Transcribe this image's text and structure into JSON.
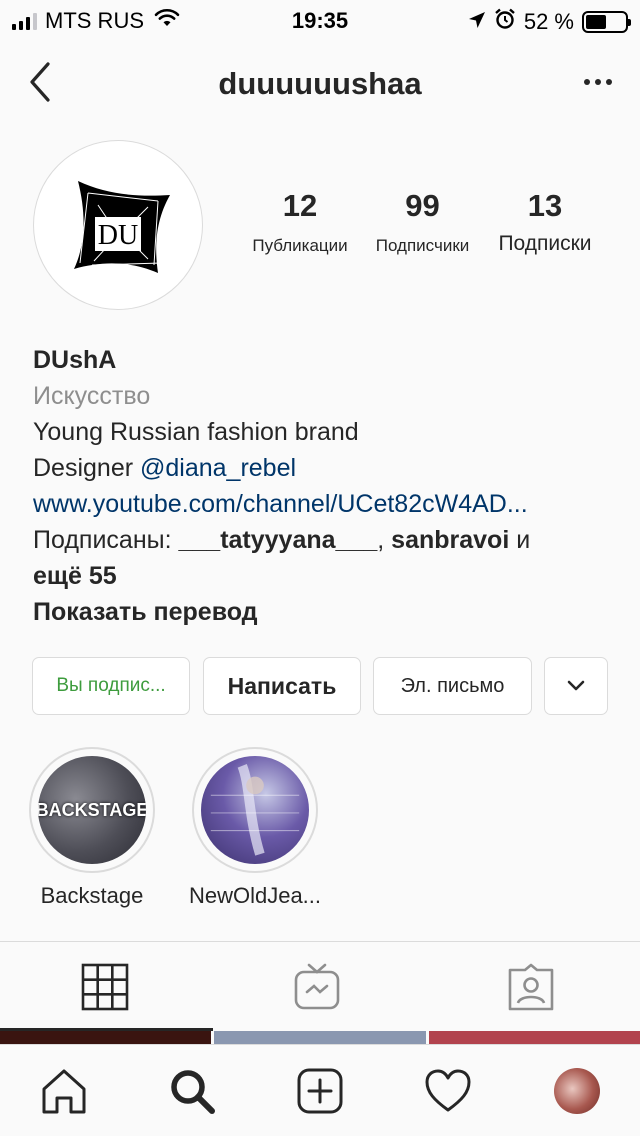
{
  "status_bar": {
    "carrier": "MTS RUS",
    "time": "19:35",
    "battery_percent": "52 %",
    "battery_level": 0.52,
    "icons": [
      "signal-icon",
      "wifi-icon",
      "location-arrow-icon",
      "alarm-clock-icon",
      "battery-icon"
    ]
  },
  "header": {
    "username": "duuuuuushaa",
    "icons": [
      "back-chevron-icon",
      "more-dots-icon"
    ]
  },
  "profile": {
    "avatar_text": "DU",
    "stats": [
      {
        "value": "12",
        "label": "Публикации"
      },
      {
        "value": "99",
        "label": "Подписчики"
      },
      {
        "value": "13",
        "label": "Подписки"
      }
    ]
  },
  "bio": {
    "name": "DUshA",
    "category": "Искусство",
    "line1": "Young Russian fashion brand",
    "designer_prefix": "Designer ",
    "designer_mention": "@diana_rebel",
    "website": "www.youtube.com/channel/UCet82cW4AD...",
    "followed_prefix": "Подписаны: ",
    "followed_user1": "___tatyyyana___",
    "followed_sep": ", ",
    "followed_user2": "sanbravoi",
    "followed_and": " и",
    "followed_more": "ещё 55",
    "translate": "Показать перевод"
  },
  "actions": {
    "following": "Вы подпис...",
    "message": "Написать",
    "email": "Эл. письмо",
    "more_icon": "chevron-down-icon"
  },
  "highlights": [
    {
      "label": "Backstage",
      "cover_text": "BACKSTAGE"
    },
    {
      "label": "NewOldJea..."
    }
  ],
  "tabs": [
    "grid-icon",
    "igtv-icon",
    "tagged-icon"
  ],
  "bottom_nav": [
    "home-icon",
    "search-icon",
    "add-post-icon",
    "heart-icon",
    "profile-avatar"
  ],
  "colors": {
    "link": "#003569",
    "following_green": "#3e9c3e",
    "secondary_text": "#8e8e8e",
    "border": "#dbdbdb"
  }
}
